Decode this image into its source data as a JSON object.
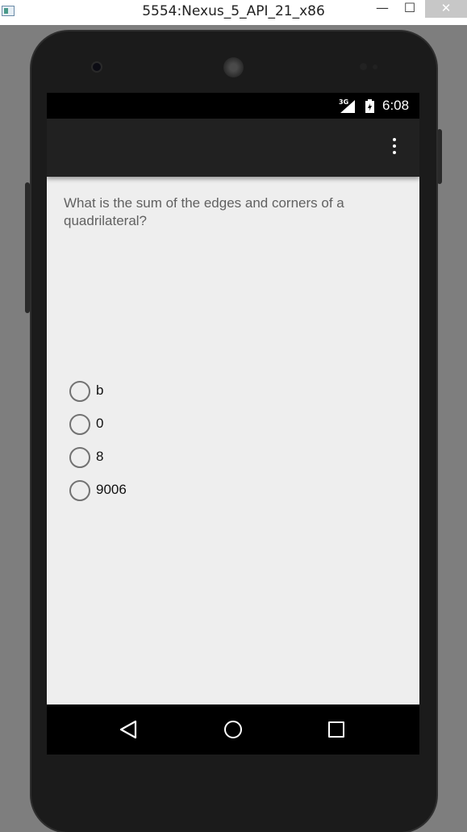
{
  "window": {
    "title": "5554:Nexus_5_API_21_x86",
    "minimize_symbol": "—",
    "maximize_symbol": "☐",
    "close_symbol": "✕"
  },
  "status_bar": {
    "network": "3G",
    "time": "6:08"
  },
  "app_bar": {
    "overflow_icon": "more-vert-icon"
  },
  "quiz": {
    "question": "What is the sum of the edges and corners of a quadrilateral?",
    "options": [
      {
        "label": "b",
        "checked": false
      },
      {
        "label": "0",
        "checked": false
      },
      {
        "label": "8",
        "checked": false
      },
      {
        "label": "9006",
        "checked": false
      }
    ]
  },
  "nav_bar": {
    "icons": [
      "back-icon",
      "home-icon",
      "recents-icon"
    ]
  },
  "colors": {
    "status_bar": "#000000",
    "app_bar": "#212121",
    "screen_background": "#eeeeee",
    "question_text": "#616161"
  }
}
